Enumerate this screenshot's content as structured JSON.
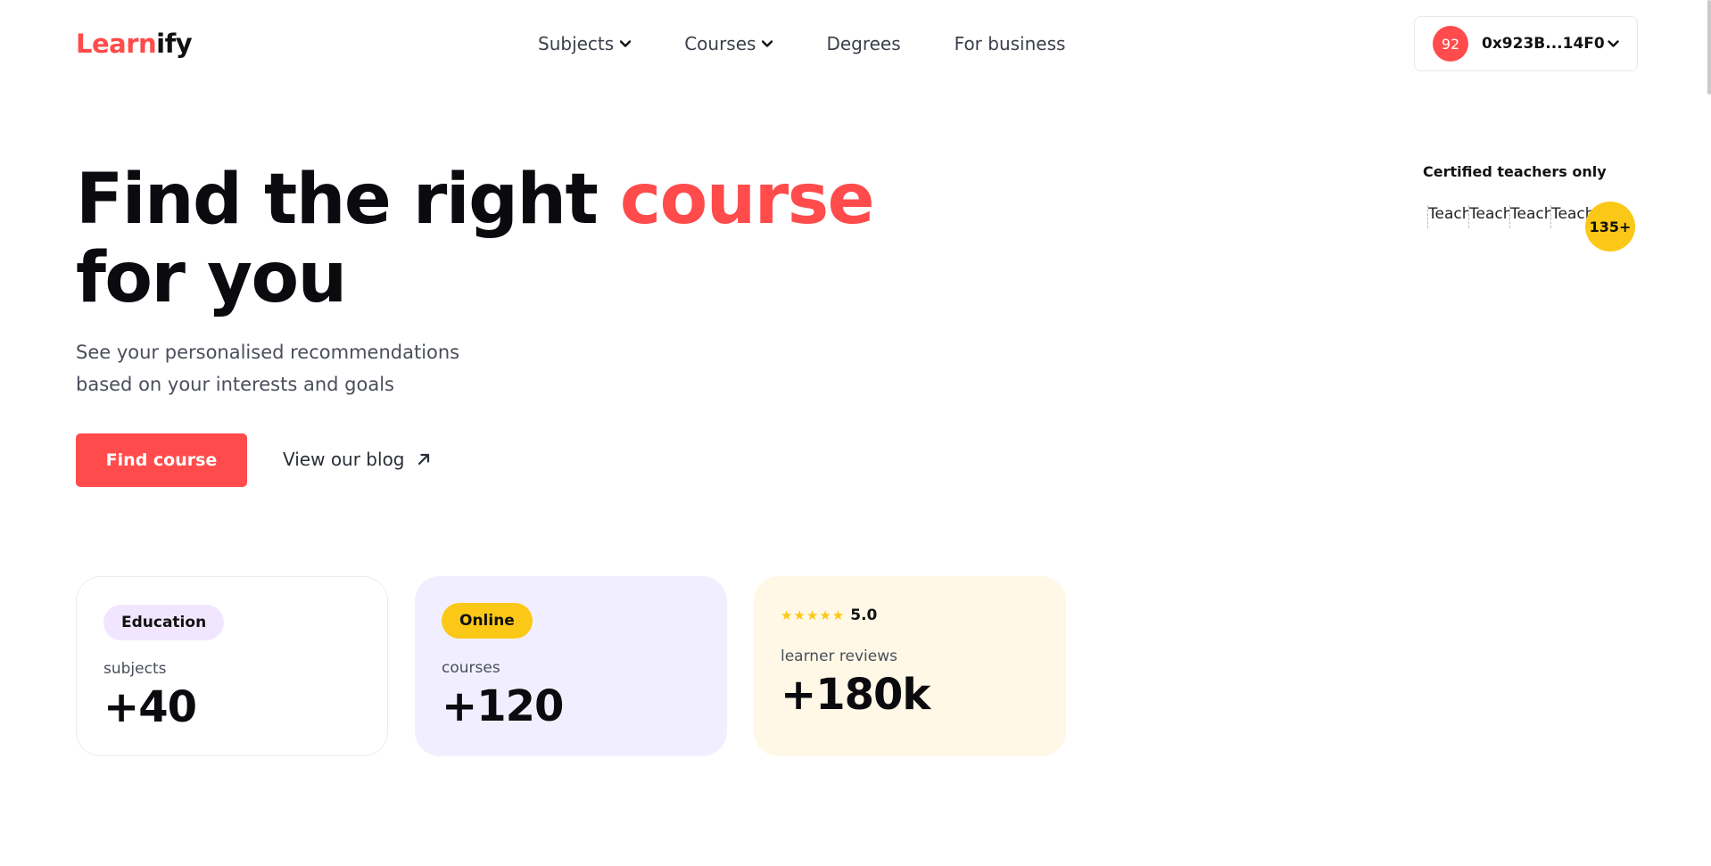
{
  "header": {
    "logo_part1": "Learn",
    "logo_part2": "ify",
    "nav": {
      "subjects": "Subjects",
      "courses": "Courses",
      "degrees": "Degrees",
      "business": "For business"
    },
    "wallet": {
      "avatar_text": "92",
      "address": "0x923B...14F0"
    }
  },
  "hero": {
    "title_part1": "Find the right ",
    "title_accent": "course",
    "title_part2": "for you",
    "subtitle_line1": "See your personalised recommendations",
    "subtitle_line2": "based on your interests and goals",
    "cta_label": "Find course",
    "blog_label": "View our blog"
  },
  "teachers": {
    "label": "Certified teachers only",
    "avatars": [
      "Teach",
      "Teach",
      "Teach",
      "Teach"
    ],
    "count": "135+"
  },
  "stats": {
    "education": {
      "badge": "Education",
      "label": "subjects",
      "value": "+40"
    },
    "online": {
      "badge": "Online",
      "label": "courses",
      "value": "+120"
    },
    "reviews": {
      "stars": "★★★★★",
      "rating": "5.0",
      "label": "learner reviews",
      "value": "+180k"
    }
  },
  "colors": {
    "accent": "#ff4b4b",
    "yellow": "#fcc817",
    "lavender": "#f1efff",
    "cream": "#fff8e6"
  },
  "icons": [
    "chevron-down-icon",
    "arrow-up-right-icon"
  ]
}
